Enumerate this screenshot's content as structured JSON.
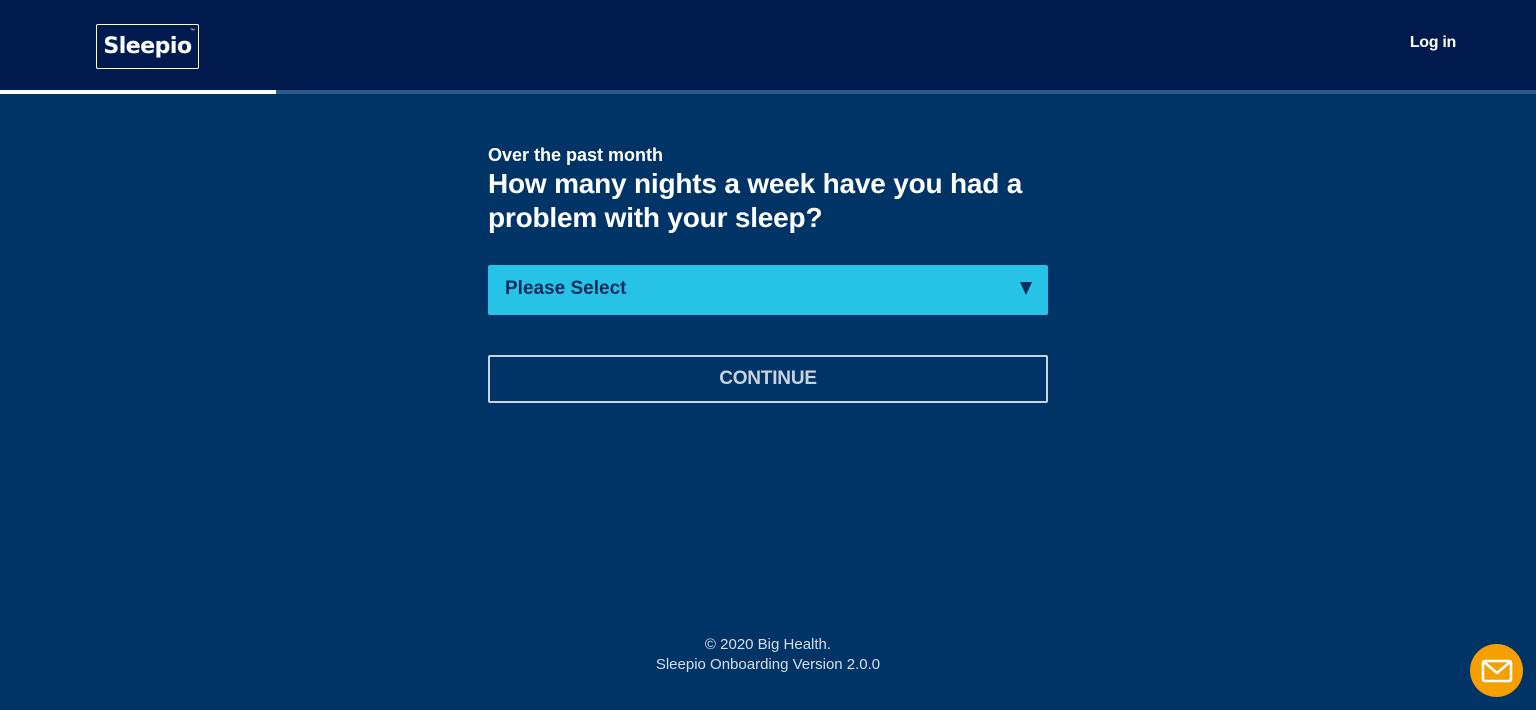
{
  "header": {
    "logo_text": "Sleepio",
    "logo_tm": "™",
    "login_label": "Log in"
  },
  "progress": {
    "fraction": 0.18
  },
  "question": {
    "eyebrow": "Over the past month",
    "title": "How many nights a week have you had a problem with your sleep?"
  },
  "select": {
    "selected_value": "Please Select"
  },
  "continue_label": "CONTINUE",
  "footer": {
    "copyright": "© 2020 Big Health.",
    "version": "Sleepio Onboarding Version 2.0.0"
  },
  "chat": {
    "icon": "envelope-icon"
  },
  "colors": {
    "header_bg": "#001a4d",
    "page_bg": "#003366",
    "select_bg": "#27c3e6",
    "chat_bg": "#f5a000"
  }
}
